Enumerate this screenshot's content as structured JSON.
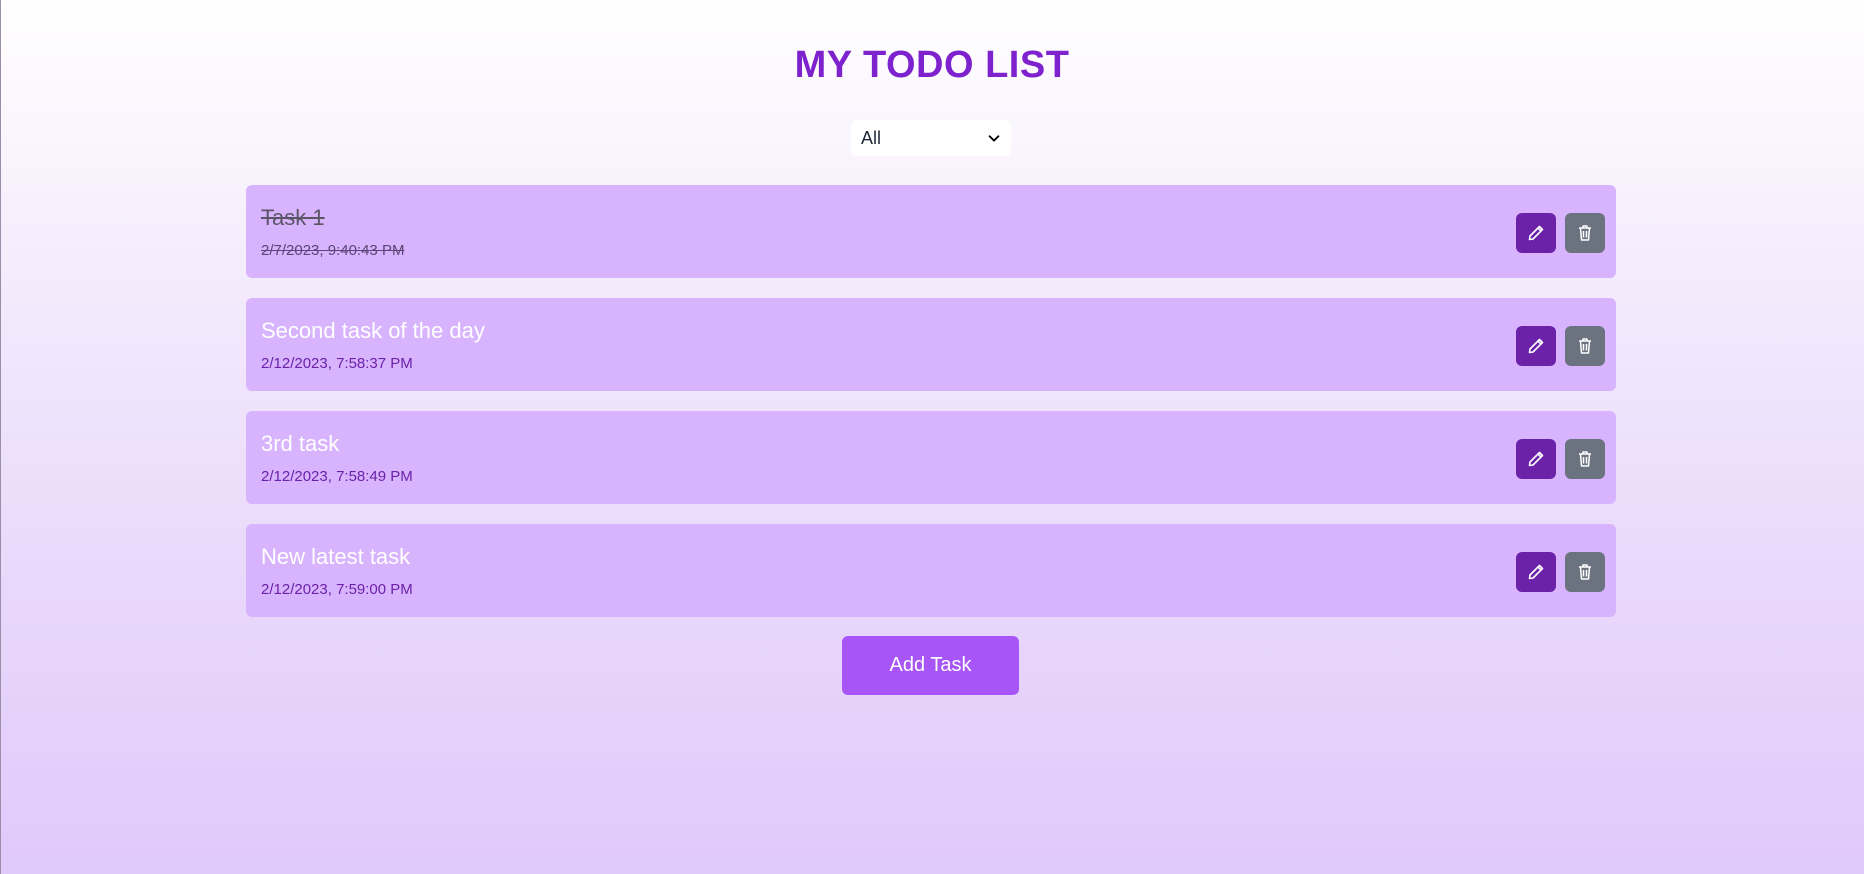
{
  "header": {
    "title": "MY TODO LIST"
  },
  "filter": {
    "selected": "All",
    "icon": "chevron-down-icon"
  },
  "tasks": [
    {
      "title": "Task 1",
      "time": "2/7/2023, 9:40:43 PM",
      "completed": true
    },
    {
      "title": "Second task of the day",
      "time": "2/12/2023, 7:58:37 PM",
      "completed": false
    },
    {
      "title": "3rd task",
      "time": "2/12/2023, 7:58:49 PM",
      "completed": false
    },
    {
      "title": "New latest task",
      "time": "2/12/2023, 7:59:00 PM",
      "completed": false
    }
  ],
  "icons": {
    "edit": "pencil-icon",
    "delete": "trash-icon"
  },
  "actions": {
    "add_label": "Add Task"
  },
  "colors": {
    "title": "#7e22ce",
    "card": "#d8b4fe",
    "edit_button": "#6b21a8",
    "delete_button": "#6b7280",
    "add_button": "#a855f7"
  }
}
